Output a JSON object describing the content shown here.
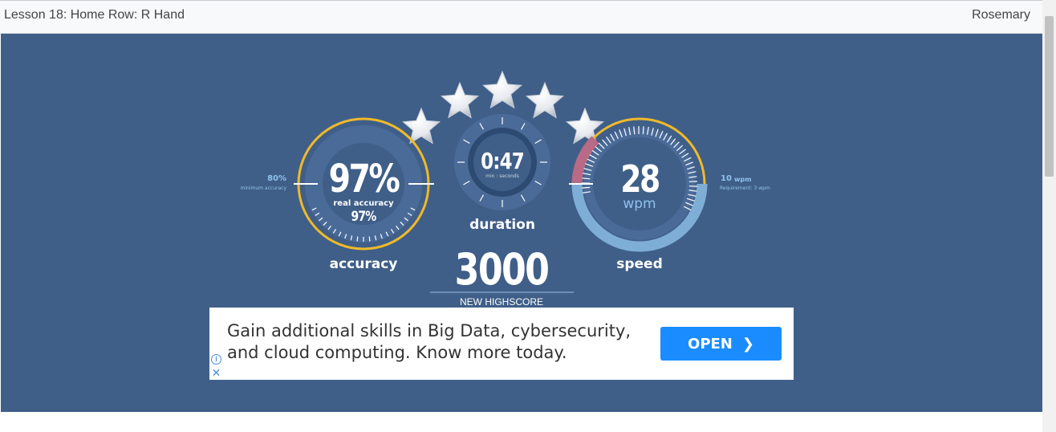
{
  "header": {
    "lesson_title": "Lesson 18: Home Row: R Hand",
    "user_name": "Rosemary"
  },
  "stars": {
    "count": 5,
    "earned": 5
  },
  "accuracy": {
    "value": "97%",
    "sub_label": "real accuracy",
    "sub_value": "97%",
    "label": "accuracy",
    "min_value": "80%",
    "min_label": "minimum accuracy",
    "fill_fraction": 0.97
  },
  "duration": {
    "value": "0:47",
    "unit": "min : seconds",
    "label": "duration"
  },
  "speed": {
    "value": "28",
    "unit": "wpm",
    "label": "speed",
    "req_value": "10",
    "req_unit": "wpm",
    "req_label": "Requirement: 3 wpm"
  },
  "score": {
    "value": "3000",
    "caption": "NEW HIGHSCORE"
  },
  "ad": {
    "text": "Gain additional skills in Big Data, cybersecurity,\nand cloud computing. Know more today.",
    "button_label": "OPEN",
    "info_icon": "info-icon",
    "close_icon": "close-icon"
  },
  "colors": {
    "background": "#3f5f88",
    "ring_gold": "#f0b92b",
    "gauge_fill": "#4a6b98",
    "speed_arc": "#7eaed6",
    "speed_red": "#b86a86",
    "label_blue": "#8fc2ec"
  }
}
